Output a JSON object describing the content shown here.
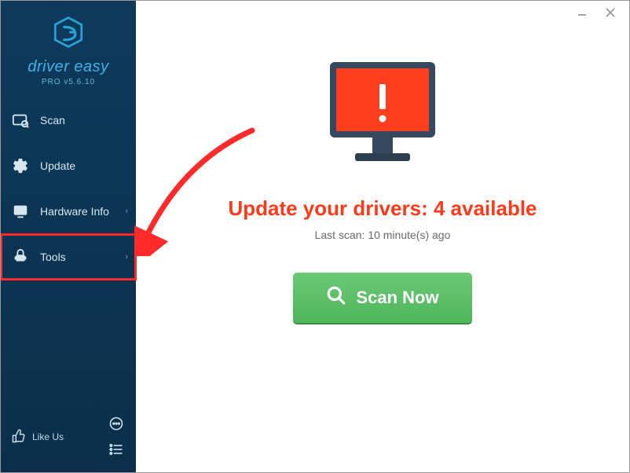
{
  "app": {
    "name": "driver easy",
    "version_label": "PRO v5.6.10"
  },
  "sidebar": {
    "items": [
      {
        "label": "Scan",
        "icon": "scan-icon",
        "has_submenu": false
      },
      {
        "label": "Update",
        "icon": "gear-icon",
        "has_submenu": false
      },
      {
        "label": "Hardware Info",
        "icon": "hardware-icon",
        "has_submenu": true
      },
      {
        "label": "Tools",
        "icon": "tools-icon",
        "has_submenu": true
      }
    ],
    "like_us_label": "Like Us"
  },
  "main": {
    "headline": "Update your drivers: 4 available",
    "last_scan_prefix": "Last scan: ",
    "last_scan_value": "10 minute(s) ago",
    "scan_button_label": "Scan Now"
  },
  "annotation": {
    "highlight_item_index": 3,
    "arrow_color": "#ff2a2a"
  },
  "colors": {
    "accent": "#3bb3e8",
    "alert": "#ff3a1a",
    "scan_green": "#56bd62",
    "sidebar_bg": "#0c3251"
  }
}
